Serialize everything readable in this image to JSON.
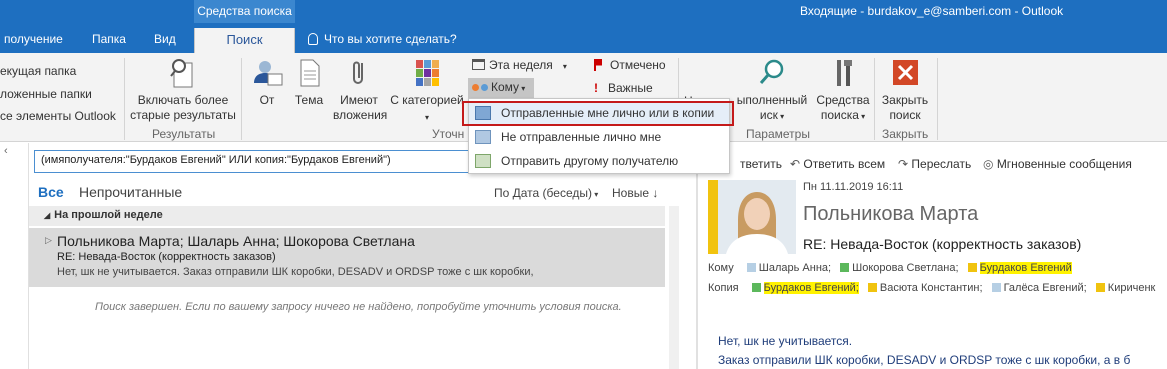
{
  "titlebar": {
    "context_label": "Средства поиска",
    "window_title": "Входящие - burdakov_e@samberi.com - Outlook"
  },
  "tabs": {
    "receive": "получение",
    "folder": "Папка",
    "view": "Вид",
    "search": "Поиск",
    "tell_me": "Что вы хотите сделать?"
  },
  "ribbon": {
    "scope": {
      "current_folder": "екущая папка",
      "subfolders": "ложенные папки",
      "all_outlook": "се элементы Outlook"
    },
    "results": {
      "include_older": "Включать более старые результаты",
      "group": "Результаты"
    },
    "refine": {
      "from": "От",
      "subject": "Тема",
      "has_attachments": "Имеют вложения",
      "categorized": "С категорией",
      "this_week": "Эта неделя",
      "to": "Кому",
      "flagged": "Отмечено",
      "important": "Важные",
      "group": "Уточн"
    },
    "options": {
      "recent": "Н",
      "partial": "ыполненный",
      "partial2": "иск",
      "tools": "Средства поиска",
      "group": "Параметры"
    },
    "close": {
      "label": "Закрыть поиск",
      "group": "Закрыть"
    }
  },
  "dropdown": {
    "items": [
      "Отправленные мне лично или в копии",
      "Не отправленные лично мне",
      "Отправить другому получателю"
    ]
  },
  "search": {
    "query": "(имяполучателя:\"Бурдаков Евгений\" ИЛИ копия:\"Бурдаков Евгений\")"
  },
  "list": {
    "filter_all": "Все",
    "filter_unread": "Непрочитанные",
    "sort": "По Дата (беседы)",
    "order": "Новые",
    "group_header": "На прошлой неделе",
    "item": {
      "from": "Польникова Марта;  Шаларь Анна;  Шокорова Светлана",
      "subject": "RE: Невада-Восток (корректность заказов)",
      "preview": "Нет, шк не учитывается.  Заказ отправили ШК коробки, DESADV  и ORDSP тоже с шк коробки,"
    },
    "status": "Поиск завершен. Если по вашему запросу ничего не найдено, попробуйте уточнить условия поиска."
  },
  "reading": {
    "actions": {
      "reply": "тветить",
      "reply_all": "Ответить всем",
      "forward": "Переслать",
      "im": "Мгновенные сообщения"
    },
    "date": "Пн 11.11.2019 16:11",
    "sender": "Польникова Марта",
    "subject": "RE: Невада-Восток (корректность заказов)",
    "to_label": "Кому",
    "to": [
      "Шаларь Анна;",
      "Шокорова Светлана;",
      "Бурдаков Евгений"
    ],
    "cc_label": "Копия",
    "cc": [
      "Бурдаков Евгений;",
      "Васюта Константин;",
      "Галёса Евгений;",
      "Кириченк"
    ],
    "body_line1": "Нет, шк не учитывается.",
    "body_line2": "Заказ отправили ШК коробки, DESADV  и ORDSP тоже с шк коробки, а в б"
  },
  "colors": {
    "accent": "#1e6fc0",
    "highlight": "#fff200",
    "red_frame": "#c41a1a"
  }
}
